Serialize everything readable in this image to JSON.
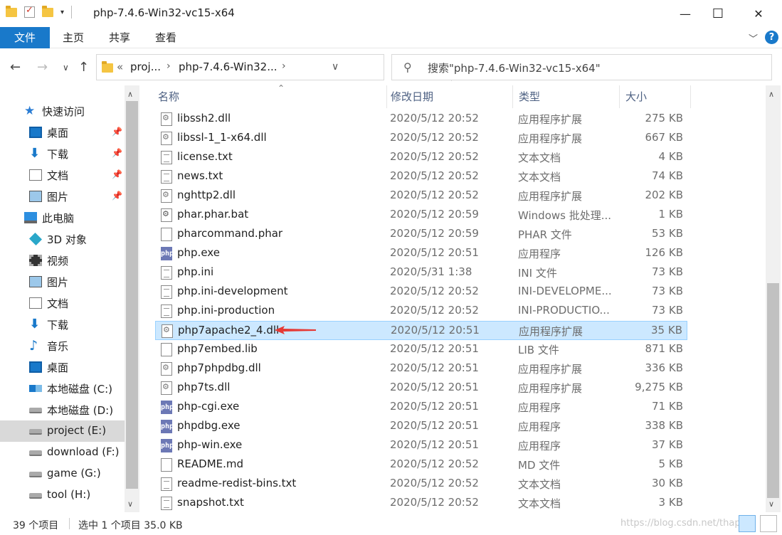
{
  "window": {
    "title": "php-7.4.6-Win32-vc15-x64",
    "minimize_glyph": "—",
    "maximize_glyph": "☐",
    "close_glyph": "✕"
  },
  "ribbon": {
    "tabs": [
      "文件",
      "主页",
      "共享",
      "查看"
    ],
    "help_glyph": "?"
  },
  "address": {
    "overflow": "«",
    "crumbs": [
      "proj...",
      "php-7.4.6-Win32..."
    ],
    "chevron": "›"
  },
  "search": {
    "placeholder": "搜索\"php-7.4.6-Win32-vc15-x64\""
  },
  "nav": {
    "items": [
      {
        "label": "快速访问",
        "icon": "star-icon",
        "pinned": false
      },
      {
        "label": "桌面",
        "icon": "desktop-icon",
        "pinned": true
      },
      {
        "label": "下载",
        "icon": "download-icon",
        "pinned": true
      },
      {
        "label": "文档",
        "icon": "documents-icon",
        "pinned": true
      },
      {
        "label": "图片",
        "icon": "pictures-icon",
        "pinned": true
      },
      {
        "label": "此电脑",
        "icon": "this-pc-icon",
        "pinned": false
      },
      {
        "label": "3D 对象",
        "icon": "3d-objects-icon",
        "pinned": false
      },
      {
        "label": "视频",
        "icon": "videos-icon",
        "pinned": false
      },
      {
        "label": "图片",
        "icon": "pictures-icon",
        "pinned": false
      },
      {
        "label": "文档",
        "icon": "documents-icon",
        "pinned": false
      },
      {
        "label": "下载",
        "icon": "download-icon",
        "pinned": false
      },
      {
        "label": "音乐",
        "icon": "music-icon",
        "pinned": false
      },
      {
        "label": "桌面",
        "icon": "desktop-icon",
        "pinned": false
      },
      {
        "label": "本地磁盘 (C:)",
        "icon": "windows-drive-icon",
        "pinned": false
      },
      {
        "label": "本地磁盘 (D:)",
        "icon": "drive-icon",
        "pinned": false
      },
      {
        "label": "project (E:)",
        "icon": "drive-icon",
        "pinned": false,
        "selected": true
      },
      {
        "label": "download (F:)",
        "icon": "drive-icon",
        "pinned": false
      },
      {
        "label": "game (G:)",
        "icon": "drive-icon",
        "pinned": false
      },
      {
        "label": "tool (H:)",
        "icon": "drive-icon",
        "pinned": false
      }
    ]
  },
  "columns": {
    "name": "名称",
    "date": "修改日期",
    "type": "类型",
    "size": "大小"
  },
  "files": [
    {
      "name": "libssh2.dll",
      "date": "2020/5/12 20:52",
      "type": "应用程序扩展",
      "size": "275 KB",
      "kind": "dll"
    },
    {
      "name": "libssl-1_1-x64.dll",
      "date": "2020/5/12 20:52",
      "type": "应用程序扩展",
      "size": "667 KB",
      "kind": "dll"
    },
    {
      "name": "license.txt",
      "date": "2020/5/12 20:52",
      "type": "文本文档",
      "size": "4 KB",
      "kind": "txt"
    },
    {
      "name": "news.txt",
      "date": "2020/5/12 20:52",
      "type": "文本文档",
      "size": "74 KB",
      "kind": "txt"
    },
    {
      "name": "nghttp2.dll",
      "date": "2020/5/12 20:52",
      "type": "应用程序扩展",
      "size": "202 KB",
      "kind": "dll"
    },
    {
      "name": "phar.phar.bat",
      "date": "2020/5/12 20:59",
      "type": "Windows 批处理...",
      "size": "1 KB",
      "kind": "bat"
    },
    {
      "name": "pharcommand.phar",
      "date": "2020/5/12 20:59",
      "type": "PHAR 文件",
      "size": "53 KB",
      "kind": "blank"
    },
    {
      "name": "php.exe",
      "date": "2020/5/12 20:51",
      "type": "应用程序",
      "size": "126 KB",
      "kind": "exe"
    },
    {
      "name": "php.ini",
      "date": "2020/5/31 1:38",
      "type": "INI 文件",
      "size": "73 KB",
      "kind": "txt"
    },
    {
      "name": "php.ini-development",
      "date": "2020/5/12 20:52",
      "type": "INI-DEVELOPME...",
      "size": "73 KB",
      "kind": "txt"
    },
    {
      "name": "php.ini-production",
      "date": "2020/5/12 20:52",
      "type": "INI-PRODUCTIO...",
      "size": "73 KB",
      "kind": "txt"
    },
    {
      "name": "php7apache2_4.dll",
      "date": "2020/5/12 20:51",
      "type": "应用程序扩展",
      "size": "35 KB",
      "kind": "dll",
      "selected": true
    },
    {
      "name": "php7embed.lib",
      "date": "2020/5/12 20:51",
      "type": "LIB 文件",
      "size": "871 KB",
      "kind": "blank"
    },
    {
      "name": "php7phpdbg.dll",
      "date": "2020/5/12 20:51",
      "type": "应用程序扩展",
      "size": "336 KB",
      "kind": "dll"
    },
    {
      "name": "php7ts.dll",
      "date": "2020/5/12 20:51",
      "type": "应用程序扩展",
      "size": "9,275 KB",
      "kind": "dll"
    },
    {
      "name": "php-cgi.exe",
      "date": "2020/5/12 20:51",
      "type": "应用程序",
      "size": "71 KB",
      "kind": "exe"
    },
    {
      "name": "phpdbg.exe",
      "date": "2020/5/12 20:51",
      "type": "应用程序",
      "size": "338 KB",
      "kind": "exe"
    },
    {
      "name": "php-win.exe",
      "date": "2020/5/12 20:51",
      "type": "应用程序",
      "size": "37 KB",
      "kind": "exe"
    },
    {
      "name": "README.md",
      "date": "2020/5/12 20:52",
      "type": "MD 文件",
      "size": "5 KB",
      "kind": "blank"
    },
    {
      "name": "readme-redist-bins.txt",
      "date": "2020/5/12 20:52",
      "type": "文本文档",
      "size": "30 KB",
      "kind": "txt"
    },
    {
      "name": "snapshot.txt",
      "date": "2020/5/12 20:52",
      "type": "文本文档",
      "size": "3 KB",
      "kind": "txt"
    }
  ],
  "exe_icon_text": "php",
  "status": {
    "count": "39 个项目",
    "selection": "选中 1 个项目  35.0 KB",
    "watermark": "https://blog.csdn.net/thaph"
  },
  "colors": {
    "accent": "#1979ca",
    "selection_bg": "#cce8ff",
    "annotation_arrow": "#e53935"
  }
}
